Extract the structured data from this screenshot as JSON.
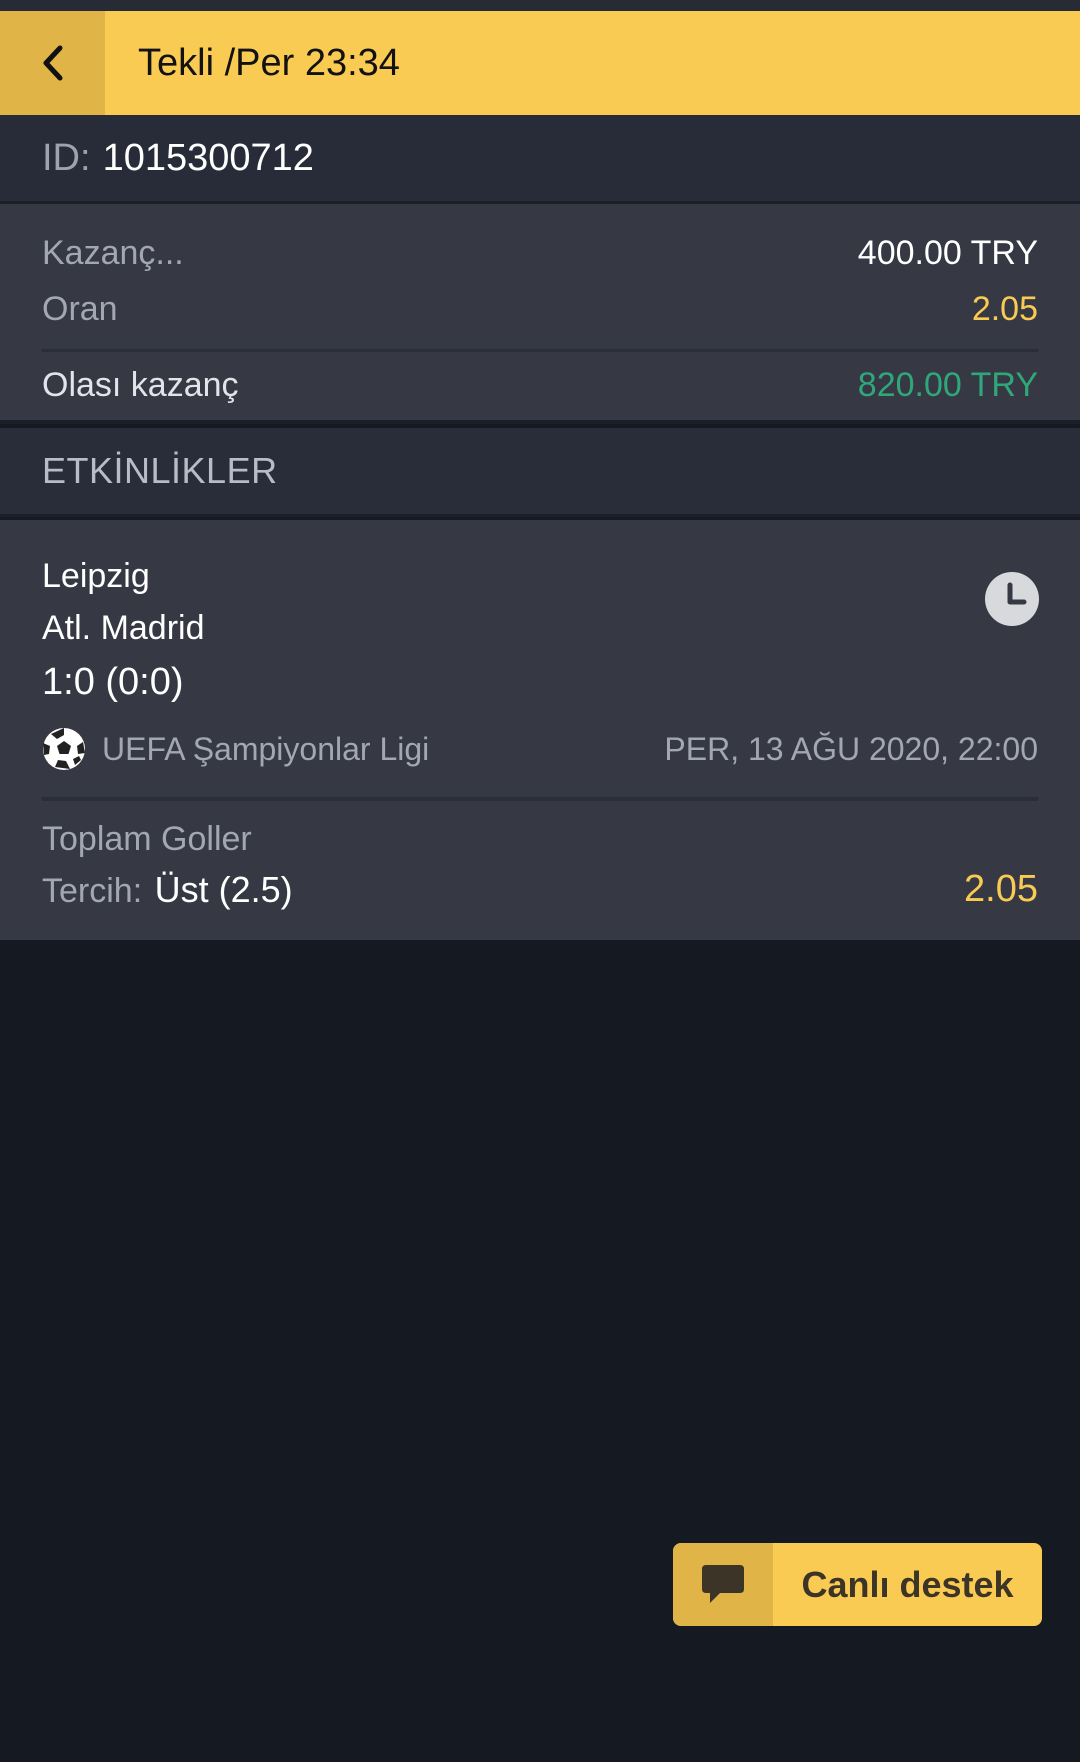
{
  "header": {
    "title": "Tekli /Per 23:34"
  },
  "ticket": {
    "id_label": "ID:",
    "id_value": "1015300712"
  },
  "summary": {
    "stake_label": "Kazanç...",
    "stake_value": "400.00 TRY",
    "odds_label": "Oran",
    "odds_value": "2.05",
    "potential_label": "Olası kazanç",
    "potential_value": "820.00 TRY"
  },
  "events_section": {
    "title": "ETKİNLİKLER"
  },
  "event": {
    "home_team": "Leipzig",
    "away_team": "Atl. Madrid",
    "score": "1:0 (0:0)",
    "league": "UEFA Şampiyonlar Ligi",
    "date": "PER, 13 AĞU 2020, 22:00",
    "market": "Toplam Goller",
    "pick_label": "Tercih:",
    "pick_value": "Üst (2.5)",
    "pick_odds": "2.05"
  },
  "support": {
    "label": "Canlı destek"
  },
  "icons": {
    "back": "chevron-left-icon",
    "clock": "clock-icon",
    "sport": "soccer-ball-icon",
    "chat": "chat-bubble-icon"
  },
  "colors": {
    "accent": "#f9cb53",
    "accent_dark": "#e0b446",
    "win_green": "#2fa77a",
    "odds_yellow": "#f9cb53",
    "background": "#151a22",
    "card": "#363944"
  }
}
